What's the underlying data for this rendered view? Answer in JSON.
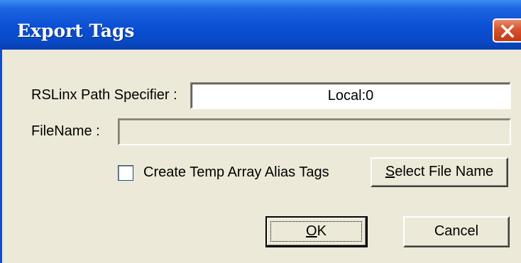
{
  "window": {
    "title": "Export Tags"
  },
  "form": {
    "path_label": "RSLinx Path Specifier :",
    "path_value": "Local:0",
    "filename_label": "FileName :",
    "filename_value": "",
    "checkbox_label": "Create Temp Array Alias Tags",
    "checkbox_checked": false
  },
  "buttons": {
    "select_file_mnemonic": "S",
    "select_file_rest": "elect File Name",
    "ok_mnemonic": "O",
    "ok_rest": "K",
    "cancel": "Cancel"
  },
  "icons": {
    "close": "close-icon"
  },
  "colors": {
    "titlebar": "#0a4fd4",
    "dialog_bg": "#ece9d8",
    "close_button": "#d6522d"
  }
}
